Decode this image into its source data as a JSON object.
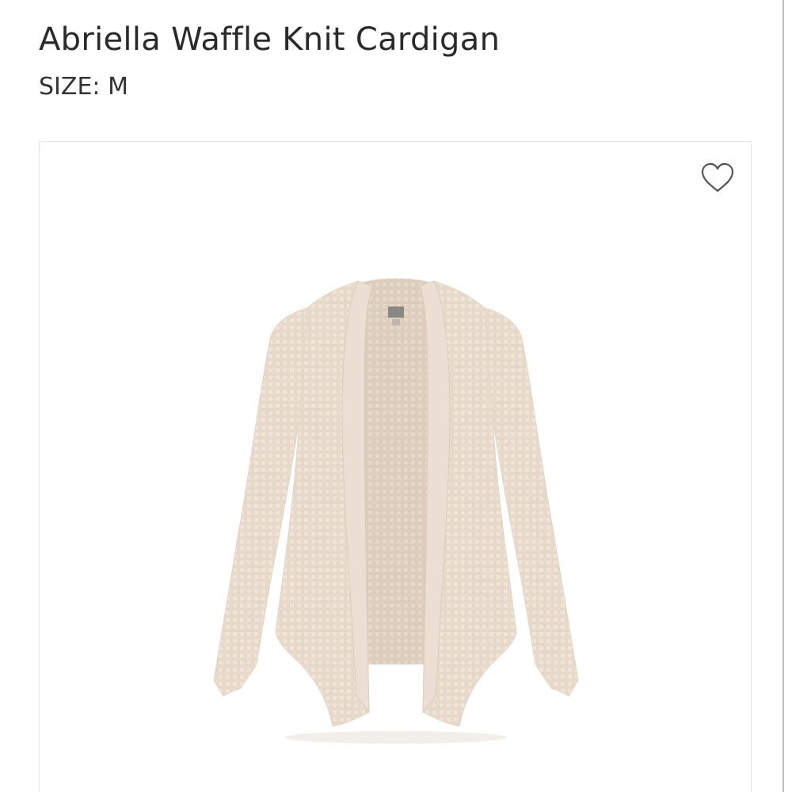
{
  "product": {
    "title": "Abriella Waffle Knit Cardigan",
    "size_label": "SIZE:",
    "size_value": "M"
  },
  "favorite": {
    "icon": "heart-outline-icon",
    "selected": false
  },
  "image": {
    "subject": "cardigan",
    "garment_color": "#efe4d8",
    "shade_color": "#dfd0c0",
    "tag_color": "#8a8784"
  },
  "colors": {
    "text": "#2a2a2a",
    "card_border": "#e6e6e6",
    "heart_stroke": "#555555"
  }
}
